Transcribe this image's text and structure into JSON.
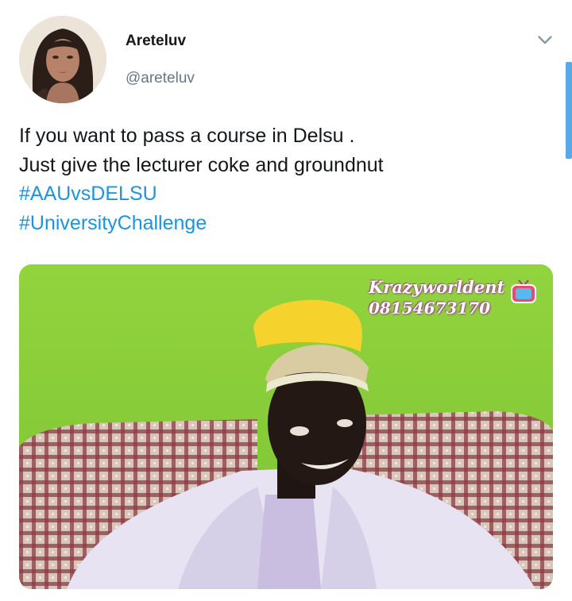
{
  "user": {
    "display_name": "Areteluv",
    "handle": "@areteluv"
  },
  "tweet": {
    "lines": [
      "If you want to pass a course in Delsu .",
      "Just give the lecturer coke and groundnut"
    ],
    "hashtags": [
      "#AAUvsDELSU",
      "#UniversityChallenge"
    ]
  },
  "media": {
    "watermark_name": "Krazyworldent",
    "watermark_phone": "08154673170",
    "watermark_icon": "tv-icon"
  },
  "icons": {
    "menu": "chevron-down-icon"
  },
  "colors": {
    "hashtag": "#1b95e0",
    "handle": "#657786",
    "text": "#14171a"
  }
}
